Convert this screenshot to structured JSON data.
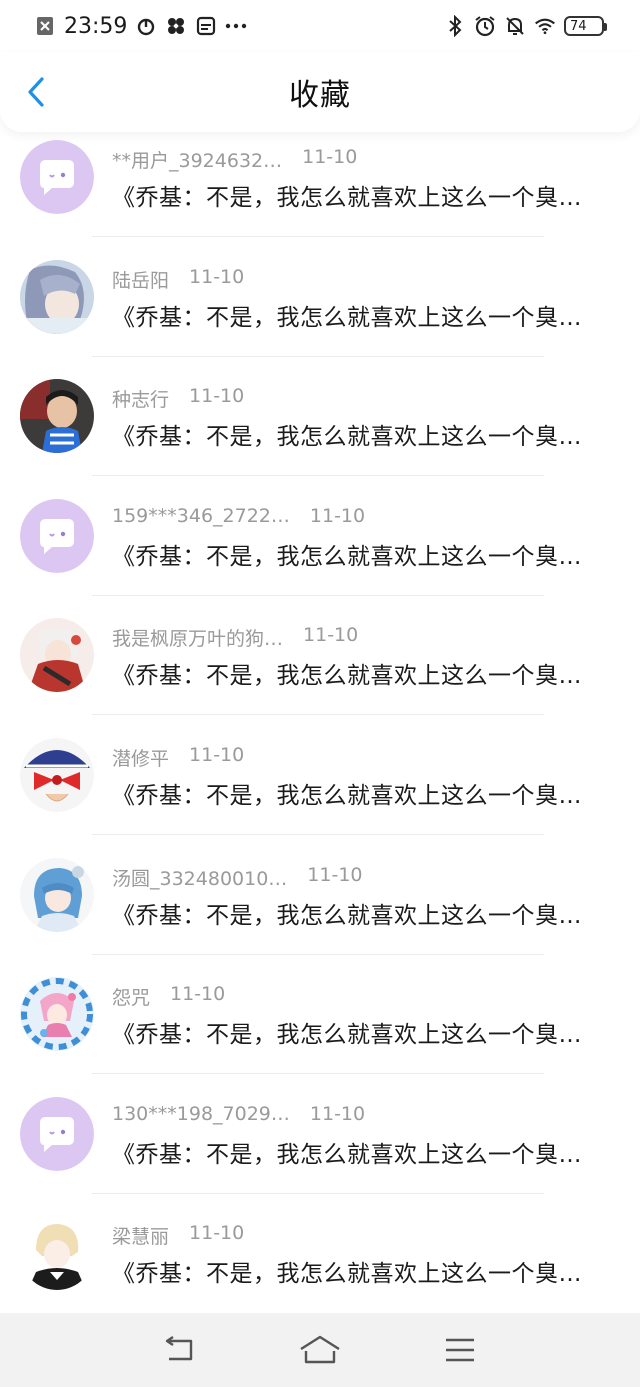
{
  "status": {
    "time": "23:59",
    "battery": "74"
  },
  "header": {
    "title": "收藏"
  },
  "items": [
    {
      "name": "**用户_3924632…",
      "date": "11-10",
      "content": "《乔基：不是，我怎么就喜欢上这么一个臭…",
      "avatar": "default-chat-avatar"
    },
    {
      "name": "陆岳阳",
      "date": "11-10",
      "content": "《乔基：不是，我怎么就喜欢上这么一个臭…",
      "avatar": "anime-avatar"
    },
    {
      "name": "种志行",
      "date": "11-10",
      "content": "《乔基：不是，我怎么就喜欢上这么一个臭…",
      "avatar": "photo-avatar"
    },
    {
      "name": "159***346_2722…",
      "date": "11-10",
      "content": "《乔基：不是，我怎么就喜欢上这么一个臭…",
      "avatar": "default-chat-avatar"
    },
    {
      "name": "我是枫原万叶的狗…",
      "date": "11-10",
      "content": "《乔基：不是，我怎么就喜欢上这么一个臭…",
      "avatar": "anime-avatar"
    },
    {
      "name": "潜修平",
      "date": "11-10",
      "content": "《乔基：不是，我怎么就喜欢上这么一个臭…",
      "avatar": "cartoon-avatar"
    },
    {
      "name": "汤圆_332480010…",
      "date": "11-10",
      "content": "《乔基：不是，我怎么就喜欢上这么一个臭…",
      "avatar": "anime-avatar"
    },
    {
      "name": "怨咒",
      "date": "11-10",
      "content": "《乔基：不是，我怎么就喜欢上这么一个臭…",
      "avatar": "anime-avatar"
    },
    {
      "name": "130***198_7029…",
      "date": "11-10",
      "content": "《乔基：不是，我怎么就喜欢上这么一个臭…",
      "avatar": "default-chat-avatar"
    },
    {
      "name": "梁慧丽",
      "date": "11-10",
      "content": "《乔基：不是，我怎么就喜欢上这么一个臭…",
      "avatar": "anime-avatar"
    }
  ],
  "nav": {
    "back": "back-icon",
    "home": "home-icon",
    "menu": "menu-icon"
  },
  "colors": {
    "accent": "#1e90e8",
    "default_avatar": "#dcc7f2",
    "meta_text": "#9a9a9a"
  }
}
